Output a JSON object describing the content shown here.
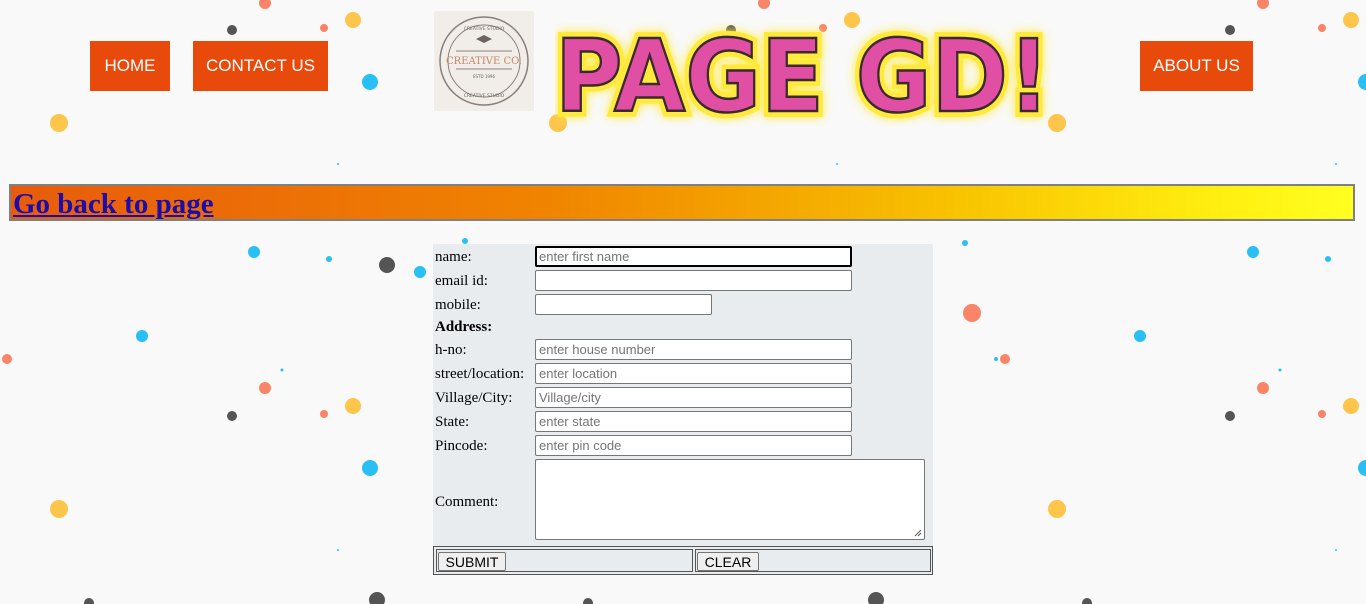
{
  "nav": {
    "home_label": "HOME",
    "contact_label": "CONTACT US",
    "about_label": "ABOUT US"
  },
  "logo": {
    "text_main": "CREATIVE CO.",
    "text_arc_top": "CREATIVE STUDIO",
    "text_arc_bottom": "CREATIVE STUDIO",
    "text_est": "ESTD 1996"
  },
  "banner": {
    "title": "PAGE GD!"
  },
  "back_link": {
    "label": "Go back to page"
  },
  "form": {
    "name_label": "name:",
    "name_placeholder": "enter first name",
    "email_label": "email id:",
    "email_placeholder": "",
    "mobile_label": "mobile:",
    "mobile_placeholder": "",
    "address_heading": "Address:",
    "hno_label": "h-no:",
    "hno_placeholder": "enter house number",
    "street_label": "street/location:",
    "street_placeholder": "enter location",
    "city_label": "Village/City:",
    "city_placeholder": "Village/city",
    "state_label": "State:",
    "state_placeholder": "enter state",
    "pincode_label": "Pincode:",
    "pincode_placeholder": "enter pin code",
    "comment_label": "Comment:",
    "submit_label": "SUBMIT",
    "clear_label": "CLEAR"
  },
  "colors": {
    "nav_button": "#e84a0c",
    "banner_text": "#e04fa4",
    "link": "#1a0dab",
    "form_bg": "#e9ecef"
  }
}
